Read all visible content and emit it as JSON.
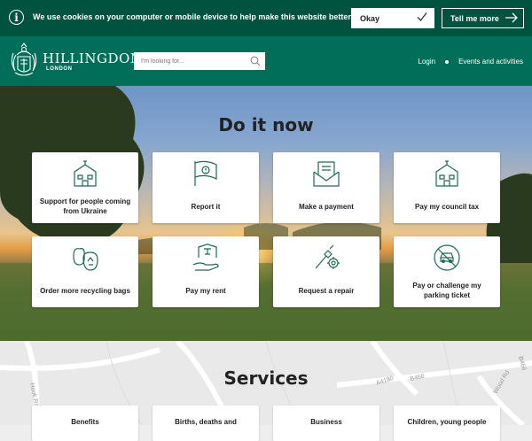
{
  "cookie": {
    "message": "We use cookies on your computer or mobile device to help make this website better.",
    "okay_label": "Okay",
    "tell_label": "Tell me more"
  },
  "header": {
    "brand": "HILLINGDON",
    "brand_sub": "LONDON",
    "search_placeholder": "I'm looking for...",
    "nav": [
      "Login",
      "Events and activities"
    ]
  },
  "do_it_now": {
    "title": "Do it now",
    "cards": [
      {
        "label": "Support for people coming from Ukraine",
        "icon": "house-icon"
      },
      {
        "label": "Report it",
        "icon": "report-flag-icon"
      },
      {
        "label": "Make a payment",
        "icon": "payment-envelope-icon"
      },
      {
        "label": "Pay my council tax",
        "icon": "council-building-icon"
      },
      {
        "label": "Order more recycling bags",
        "icon": "recycling-bags-icon"
      },
      {
        "label": "Pay my rent",
        "icon": "rent-house-icon"
      },
      {
        "label": "Request a repair",
        "icon": "repair-tools-icon"
      },
      {
        "label": "Pay or challenge my parking ticket",
        "icon": "no-parking-icon"
      }
    ]
  },
  "services": {
    "title": "Services",
    "cards": [
      "Benefits",
      "Births, deaths and",
      "Business",
      "Children, young people"
    ],
    "map_labels": [
      "A4180",
      "B466",
      "Hook Rd",
      "Wood Rd",
      "B466"
    ]
  },
  "colors": {
    "cookie_bg": "#00543f",
    "header_bg": "#006e58",
    "icon_green": "#1d6b52"
  }
}
